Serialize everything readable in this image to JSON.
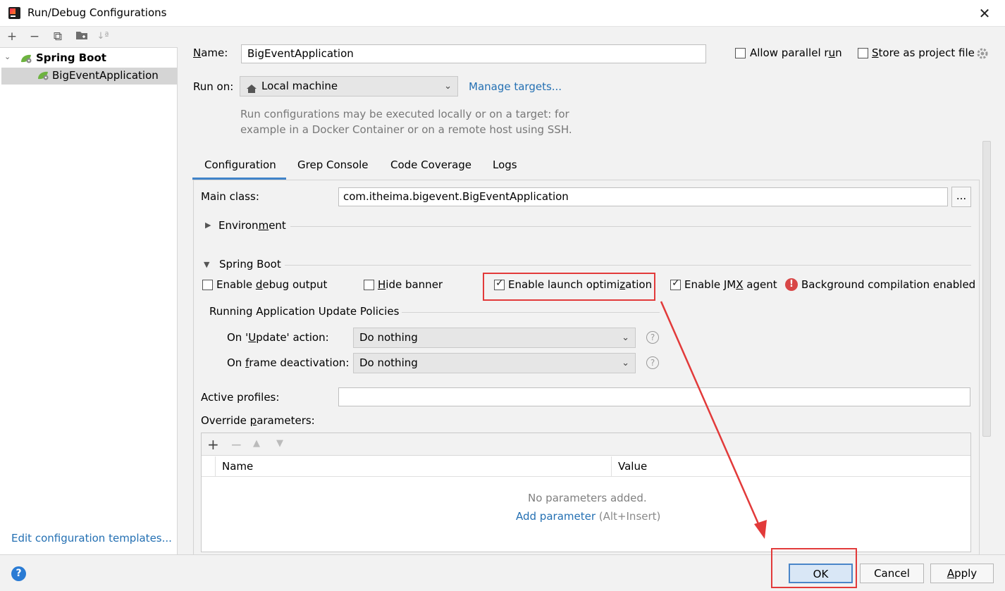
{
  "window": {
    "title": "Run/Debug Configurations",
    "close_glyph": "✕"
  },
  "left": {
    "toolbar": [
      "+",
      "−",
      "⧉",
      "📁",
      "↓ª"
    ],
    "tree_arrow": "⌄",
    "group": "Spring Boot",
    "item": "BigEventApplication",
    "edit_templates": "Edit configuration templates..."
  },
  "form": {
    "name_label_u": "N",
    "name_label_rest": "ame:",
    "name_value": "BigEventApplication",
    "allow_parallel_pre": "Allow parallel r",
    "allow_parallel_u": "u",
    "allow_parallel_post": "n",
    "store_pre": "",
    "store_u": "S",
    "store_post": "tore as project file",
    "run_on_label": "Run on:",
    "run_on_value": "Local machine",
    "manage_targets": "Manage targets...",
    "run_help_line1": "Run configurations may be executed locally or on a target: for",
    "run_help_line2": "example in a Docker Container or on a remote host using SSH."
  },
  "tabs": [
    "Configuration",
    "Grep Console",
    "Code Coverage",
    "Logs"
  ],
  "config": {
    "main_class_label": "Main class:",
    "main_class_value": "com.itheima.bigevent.BigEventApplication",
    "dots": "...",
    "environment_pre": "Environ",
    "environment_u": "m",
    "environment_post": "ent",
    "spring_boot_section": "Spring Boot",
    "debug_pre": "Enable ",
    "debug_u": "d",
    "debug_post": "ebug output",
    "hide_pre": "",
    "hide_u": "H",
    "hide_post": "ide banner",
    "launch_pre": "Enable launch optimi",
    "launch_u": "z",
    "launch_post": "ation",
    "jmx_pre": "Enable JM",
    "jmx_u": "X",
    "jmx_post": " agent",
    "bg_compile": "Background compilation enabled",
    "policies_title": "Running Application Update Policies",
    "update_pre": "On '",
    "update_u": "U",
    "update_post": "pdate' action:",
    "update_value": "Do nothing",
    "frame_pre": "On ",
    "frame_u": "f",
    "frame_post": "rame deactivation:",
    "frame_value": "Do nothing",
    "active_profiles_label": "Active profiles:",
    "active_profiles_value": "",
    "override_pre": "Override ",
    "override_u": "p",
    "override_post": "arameters:",
    "table_tools": [
      "+",
      "−",
      "▲",
      "▼"
    ],
    "col_name": "Name",
    "col_value": "Value",
    "empty": "No parameters added.",
    "add_param": "Add parameter",
    "add_param_hint": "(Alt+Insert)"
  },
  "buttons": {
    "help": "?",
    "ok": "OK",
    "cancel": "Cancel",
    "apply_u": "A",
    "apply_post": "pply"
  },
  "colors": {
    "accent": "#2470b3",
    "highlight_box": "#e23a3a",
    "selection": "#d5d5d5"
  }
}
